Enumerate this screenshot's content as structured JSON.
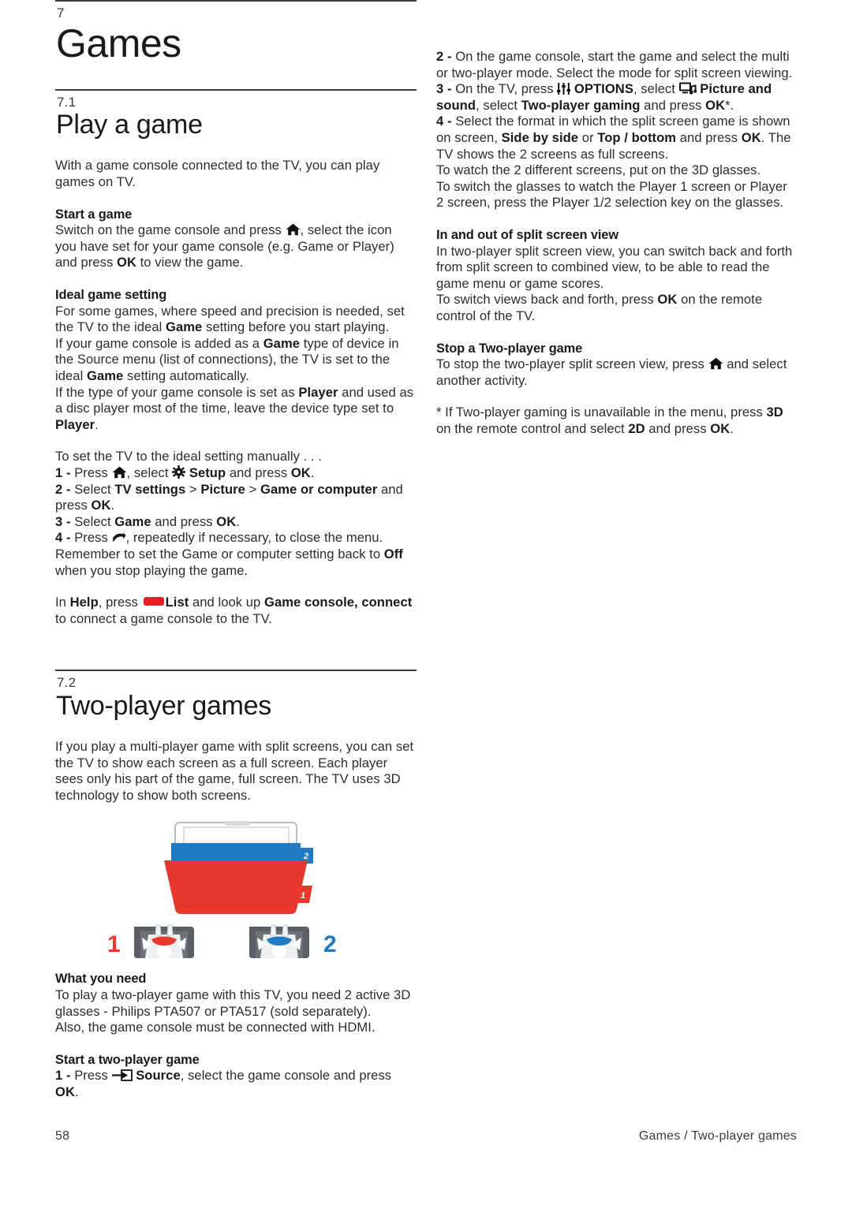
{
  "chapter": {
    "number": "7",
    "title": "Games"
  },
  "section_71": {
    "number": "7.1",
    "title": "Play a game",
    "intro": "With a game console connected to the TV, you can play games on TV.",
    "start_a_game": {
      "heading": "Start a game",
      "line1_a": "Switch on the game console and press ",
      "line1_b": ", select the icon you have set for your game console (e.g. Game or Player) and press ",
      "ok": "OK",
      "line1_c": " to view the game."
    },
    "ideal": {
      "heading": "Ideal game setting",
      "p1_a": "For some games, where speed and precision is needed, set the TV to the ideal ",
      "p1_game": "Game",
      "p1_b": " setting before you start playing.",
      "p2_a": "If your game console is added as a ",
      "p2_game": "Game",
      "p2_b": " type of device in the Source menu (list of connections), the TV is set to the ideal ",
      "p2_game2": "Game",
      "p2_c": " setting automatically.",
      "p3_a": "If the type of your game console is set as ",
      "p3_player": "Player",
      "p3_b": " and used as a disc player most of the time, leave the device type set to ",
      "p3_player2": "Player",
      "p3_c": "."
    },
    "manual": {
      "lead": "To set the TV to the ideal setting manually . . .",
      "step1_num": "1 - ",
      "step1_a": "Press ",
      "step1_b": ", select ",
      "step1_setup": "Setup",
      "step1_c": " and press ",
      "step1_ok": "OK",
      "step1_d": ".",
      "step2_num": "2 - ",
      "step2_a": "Select ",
      "step2_tv": "TV settings",
      "step2_gt1": " > ",
      "step2_pic": "Picture",
      "step2_gt2": " > ",
      "step2_goc": "Game or computer",
      "step2_b": " and press ",
      "step2_ok": "OK",
      "step2_c": ".",
      "step3_num": "3 - ",
      "step3_a": "Select ",
      "step3_game": "Game",
      "step3_b": " and press ",
      "step3_ok": "OK",
      "step3_c": ".",
      "step4_num": "4 - ",
      "step4_a": "Press ",
      "step4_b": ", repeatedly if necessary, to close the menu.",
      "remember_a": "Remember to set the Game or computer setting back to ",
      "remember_off": "Off",
      "remember_b": " when you stop playing the game."
    },
    "help": {
      "a": "In ",
      "help": "Help",
      "b": ", press ",
      "list": "List",
      "c": " and look up ",
      "topic": "Game console, connect",
      "d": " to connect a game console to the TV."
    }
  },
  "section_72": {
    "number": "7.2",
    "title": "Two-player games",
    "intro": "If you play a multi-player game with split screens, you can set the TV to show each screen as a full screen. Each player sees only his part of the game, full screen. The TV uses 3D technology to show both screens.",
    "illustration": {
      "label_player1": "1",
      "label_player2": "2",
      "screen_tab1": "1",
      "screen_tab2": "2",
      "color_player1": "#e8372c",
      "color_player2": "#1f7cc4"
    },
    "what_you_need": {
      "heading": "What you need",
      "p1": "To play a two-player game with this TV, you need 2 active 3D glasses - Philips PTA507 or PTA517 (sold separately).",
      "p2": "Also, the game console must be connected with HDMI."
    },
    "start_two_player": {
      "heading": "Start a two-player game",
      "step1_num": "1 - ",
      "step1_a": "Press ",
      "source": "Source",
      "step1_b": ", select the game console and press ",
      "step1_ok": "OK",
      "step1_c": "."
    }
  },
  "right_column": {
    "step2_num": "2 - ",
    "step2_text": "On the game console, start the game and select the multi or two-player mode. Select the mode for split screen viewing.",
    "step3_num": "3 - ",
    "step3_a": "On the TV, press ",
    "step3_options": "OPTIONS",
    "step3_b": ", select ",
    "step3_picsound": "Picture and sound",
    "step3_c": ", select ",
    "step3_twoplayer": "Two-player gaming",
    "step3_d": " and press ",
    "step3_ok": "OK",
    "step3_e": "*.",
    "step4_num": "4 - ",
    "step4_a": "Select the format in which the split screen game is shown on screen, ",
    "step4_sbs": "Side by side",
    "step4_b": " or ",
    "step4_tb": "Top / bottom",
    "step4_c": " and press ",
    "step4_ok": "OK",
    "step4_d": ". The TV shows the 2 screens as full screens.",
    "p_glasses": "To watch the 2 different screens, put on the 3D glasses.",
    "p_switch": "To switch the glasses to watch the Player 1 screen or Player 2 screen, press the Player 1/2 selection key on the glasses.",
    "inout": {
      "heading": "In and out of split screen view",
      "p1": "In two-player split screen view, you can switch back and forth from split screen to combined view, to be able to read the game menu or game scores.",
      "p2_a": "To switch views back and forth, press ",
      "p2_ok": "OK",
      "p2_b": " on the remote control of the TV."
    },
    "stop": {
      "heading": "Stop a Two-player game",
      "p_a": "To stop the two-player split screen view, press ",
      "p_b": " and select another activity."
    },
    "footnote": {
      "a": "* If Two-player gaming is unavailable in the menu, press ",
      "three_d": "3D",
      "b": " on the remote control and select ",
      "two_d": "2D",
      "c": " and press ",
      "ok": "OK",
      "d": "."
    }
  },
  "footer": {
    "page_number": "58",
    "breadcrumb": "Games / Two-player games"
  }
}
